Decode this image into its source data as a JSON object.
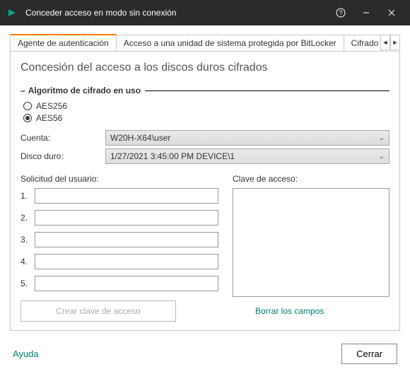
{
  "titlebar": {
    "title": "Conceder acceso en modo sin conexión"
  },
  "tabs": {
    "tab1": "Agente de autenticación",
    "tab2": "Acceso a una unidad de sistema protegida por BitLocker",
    "tab3": "Cifrado de datos"
  },
  "page": {
    "title": "Concesión del acceso a los discos duros cifrados"
  },
  "fieldset": {
    "label": "Algoritmo de cifrado en uso"
  },
  "radios": {
    "aes256": "AES256",
    "aes56": "AES56"
  },
  "fields": {
    "account_label": "Cuenta:",
    "account_value": "W20H-X64\\user",
    "disk_label": "Disco duro:",
    "disk_value": "1/27/2021 3:45:00 PM  DEVICE\\1"
  },
  "request": {
    "label": "Solicitud del usuario:",
    "n1": "1.",
    "n2": "2.",
    "n3": "3.",
    "n4": "4.",
    "n5": "5."
  },
  "accesskey": {
    "label": "Clave de acceso:"
  },
  "buttons": {
    "create_key": "Crear clave de acceso",
    "clear_fields": "Borrar los campos"
  },
  "footer": {
    "help": "Ayuda",
    "close": "Cerrar"
  }
}
